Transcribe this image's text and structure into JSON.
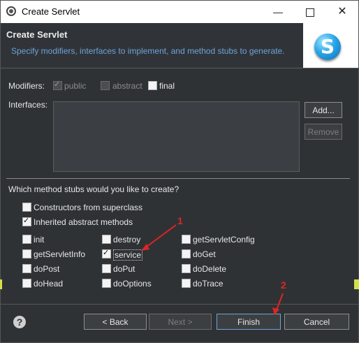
{
  "window": {
    "title": "Create Servlet",
    "min_glyph": "—",
    "close_glyph": "✕"
  },
  "header": {
    "title": "Create Servlet",
    "description": "Specify modifiers, interfaces to implement, and method stubs to generate.",
    "logo_letter": "S"
  },
  "modifiers": {
    "label": "Modifiers:",
    "options": [
      {
        "label": "public",
        "checked": true,
        "enabled": false
      },
      {
        "label": "abstract",
        "checked": false,
        "enabled": false
      },
      {
        "label": "final",
        "checked": false,
        "enabled": true
      }
    ]
  },
  "interfaces": {
    "label": "Interfaces:",
    "add_button": "Add...",
    "remove_button": "Remove"
  },
  "stubs": {
    "question": "Which method stubs would you like to create?",
    "constructors": {
      "label": "Constructors from superclass",
      "checked": false
    },
    "inherited": {
      "label": "Inherited abstract methods",
      "checked": true
    },
    "methods": [
      {
        "label": "init",
        "checked": false
      },
      {
        "label": "destroy",
        "checked": false
      },
      {
        "label": "getServletConfig",
        "checked": false
      },
      {
        "label": "getServletInfo",
        "checked": false
      },
      {
        "label": "service",
        "checked": true
      },
      {
        "label": "doGet",
        "checked": false
      },
      {
        "label": "doPost",
        "checked": false
      },
      {
        "label": "doPut",
        "checked": false
      },
      {
        "label": "doDelete",
        "checked": false
      },
      {
        "label": "doHead",
        "checked": false
      },
      {
        "label": "doOptions",
        "checked": false
      },
      {
        "label": "doTrace",
        "checked": false
      }
    ]
  },
  "footer": {
    "help_glyph": "?",
    "back": "< Back",
    "next": "Next >",
    "finish": "Finish",
    "cancel": "Cancel"
  },
  "annotations": {
    "one": "1",
    "two": "2",
    "color": "#e02424"
  },
  "colors": {
    "accent_desc": "#6ea3d6",
    "panel": "#2f3235"
  }
}
